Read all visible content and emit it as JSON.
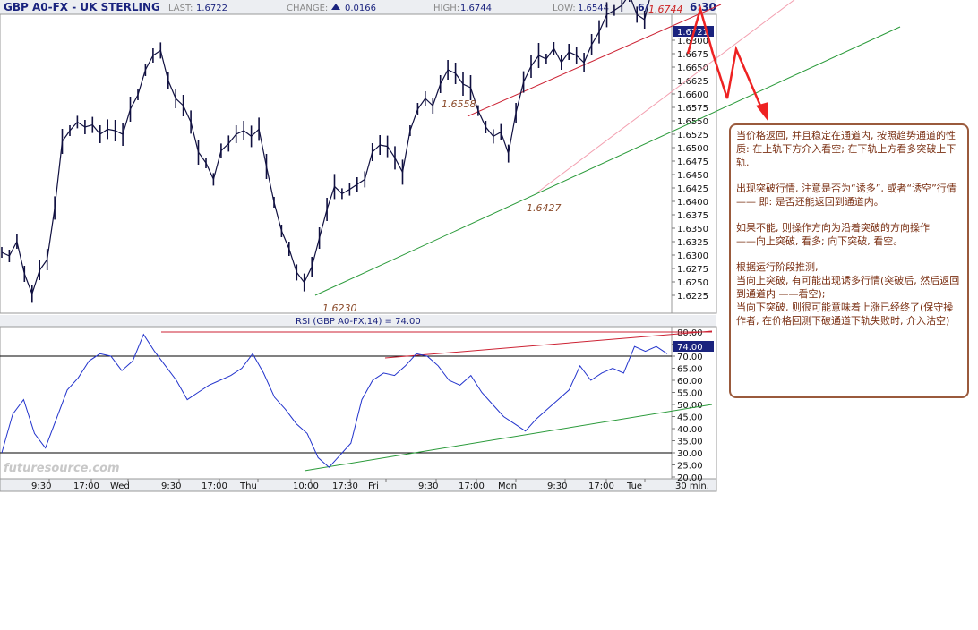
{
  "header": {
    "symbol": "GBP A0-FX - UK STERLING",
    "last_label": "LAST:",
    "last_value": "1.6722",
    "change_label": "CHANGE:",
    "change_value": "0.0166",
    "high_label": "HIGH:",
    "high_value": "1.6744",
    "low_label": "LOW:",
    "low_value": "1.6544",
    "date_partial": "6/",
    "time": "6:30"
  },
  "rsi_title": "RSI (GBP A0-FX,14) = 74.00",
  "interval_label": "30 min.",
  "watermark": "futuresource.com",
  "colors": {
    "red_channel": "#cc2233",
    "pink_channel": "#f3a0b0",
    "green_channel": "#2a9a3a",
    "price_line": "#101040",
    "rsi_line": "#2233cc",
    "annotation": "#7a2f12",
    "arrow": "#ee2222",
    "current_tag_bg": "#1a237e"
  },
  "chart_data": [
    {
      "type": "candlestick",
      "title": "GBP A0-FX - UK STERLING",
      "ylim": [
        1.62,
        1.6744
      ],
      "y_ticks": [
        "1.6300",
        "1.6675",
        "1.6650",
        "1.6625",
        "1.6600",
        "1.6575",
        "1.6550",
        "1.6525",
        "1.6500",
        "1.6475",
        "1.6450",
        "1.6425",
        "1.6400",
        "1.6375",
        "1.6350",
        "1.6325",
        "1.6300",
        "1.6275",
        "1.6250",
        "1.6225"
      ],
      "current_value_tag": "1.6721",
      "x_ticks": [
        "9:30",
        "17:00",
        "Wed",
        "9:30",
        "17:00",
        "Thu",
        "10:00",
        "17:30",
        "Fri",
        "9:30",
        "17:00",
        "Mon",
        "9:30",
        "17:00",
        "Tue"
      ],
      "price_labels": [
        {
          "text": "1.6558",
          "value": 1.6558
        },
        {
          "text": "1.6427",
          "value": 1.6427
        },
        {
          "text": "1.6230",
          "value": 1.623
        },
        {
          "text": "1.6744",
          "value": 1.6744
        }
      ],
      "series": [
        {
          "close_path": [
            1.629,
            1.6285,
            1.6305,
            1.626,
            1.6232,
            1.6265,
            1.628,
            1.6352,
            1.6445,
            1.646,
            1.6472,
            1.6465,
            1.6468,
            1.6455,
            1.6462,
            1.646,
            1.6455,
            1.649,
            1.651,
            1.6545,
            1.6565,
            1.6572,
            1.653,
            1.6505,
            1.6495,
            1.6472,
            1.643,
            1.6415,
            1.6392,
            1.6432,
            1.6442,
            1.6455,
            1.646,
            1.6452,
            1.6462,
            1.641,
            1.636,
            1.632,
            1.6295,
            1.6262,
            1.6248,
            1.627,
            1.631,
            1.635,
            1.6382,
            1.6372,
            1.6378,
            1.6385,
            1.6392,
            1.643,
            1.644,
            1.6438,
            1.6422,
            1.6402,
            1.646,
            1.649,
            1.6505,
            1.6495,
            1.6525,
            1.6545,
            1.654,
            1.6525,
            1.652,
            1.6488,
            1.6465,
            1.6452,
            1.6458,
            1.6428,
            1.6485,
            1.6528,
            1.655,
            1.6565,
            1.656,
            1.6575,
            1.6555,
            1.657,
            1.6565,
            1.6555,
            1.658,
            1.6598,
            1.6622,
            1.6628,
            1.6635,
            1.665,
            1.6622,
            1.6615,
            1.6658,
            1.6715,
            1.6721
          ]
        }
      ]
    },
    {
      "type": "line",
      "title": "RSI (GBP A0-FX,14) = 74.00",
      "ylim": [
        20,
        80
      ],
      "y_ticks": [
        "80.00",
        "75.00",
        "70.00",
        "65.00",
        "60.00",
        "55.00",
        "50.00",
        "45.00",
        "40.00",
        "35.00",
        "30.00",
        "25.00",
        "20.00"
      ],
      "current_value_tag": "74.00",
      "reference_lines": [
        70,
        30
      ],
      "series": [
        {
          "values": [
            30,
            46,
            52,
            38,
            32,
            44,
            56,
            61,
            68,
            71,
            70,
            64,
            68,
            79,
            72,
            66,
            60,
            52,
            55,
            58,
            60,
            62,
            65,
            71,
            63,
            53,
            48,
            42,
            38,
            28,
            24,
            29,
            34,
            52,
            60,
            63,
            62,
            66,
            71,
            70,
            66,
            60,
            58,
            62,
            55,
            50,
            45,
            42,
            39,
            44,
            48,
            52,
            56,
            66,
            60,
            63,
            65,
            63,
            74,
            72,
            74,
            71
          ]
        }
      ]
    }
  ],
  "annotation": {
    "p1": "当价格返回, 并且稳定在通道内, 按照趋势通道的性质: 在上轨下方介入看空; 在下轨上方看多突破上下轨.",
    "p2a": "出现突破行情, 注意是否为“诱多”, 或者“诱空”行情",
    "p2b": "—— 即: 是否还能返回到通道内。",
    "p3a": "如果不能, 则操作方向为沿着突破的方向操作",
    "p3b": "——向上突破, 看多; 向下突破, 看空。",
    "p4a": "根据运行阶段推测,",
    "p4b": "当向上突破, 有可能出现诱多行情(突破后, 然后返回到通道内 ——看空);",
    "p4c": "当向下突破, 则很可能意味着上涨已经终了(保守操作者, 在价格回测下破通道下轨失败时, 介入沽空)"
  }
}
